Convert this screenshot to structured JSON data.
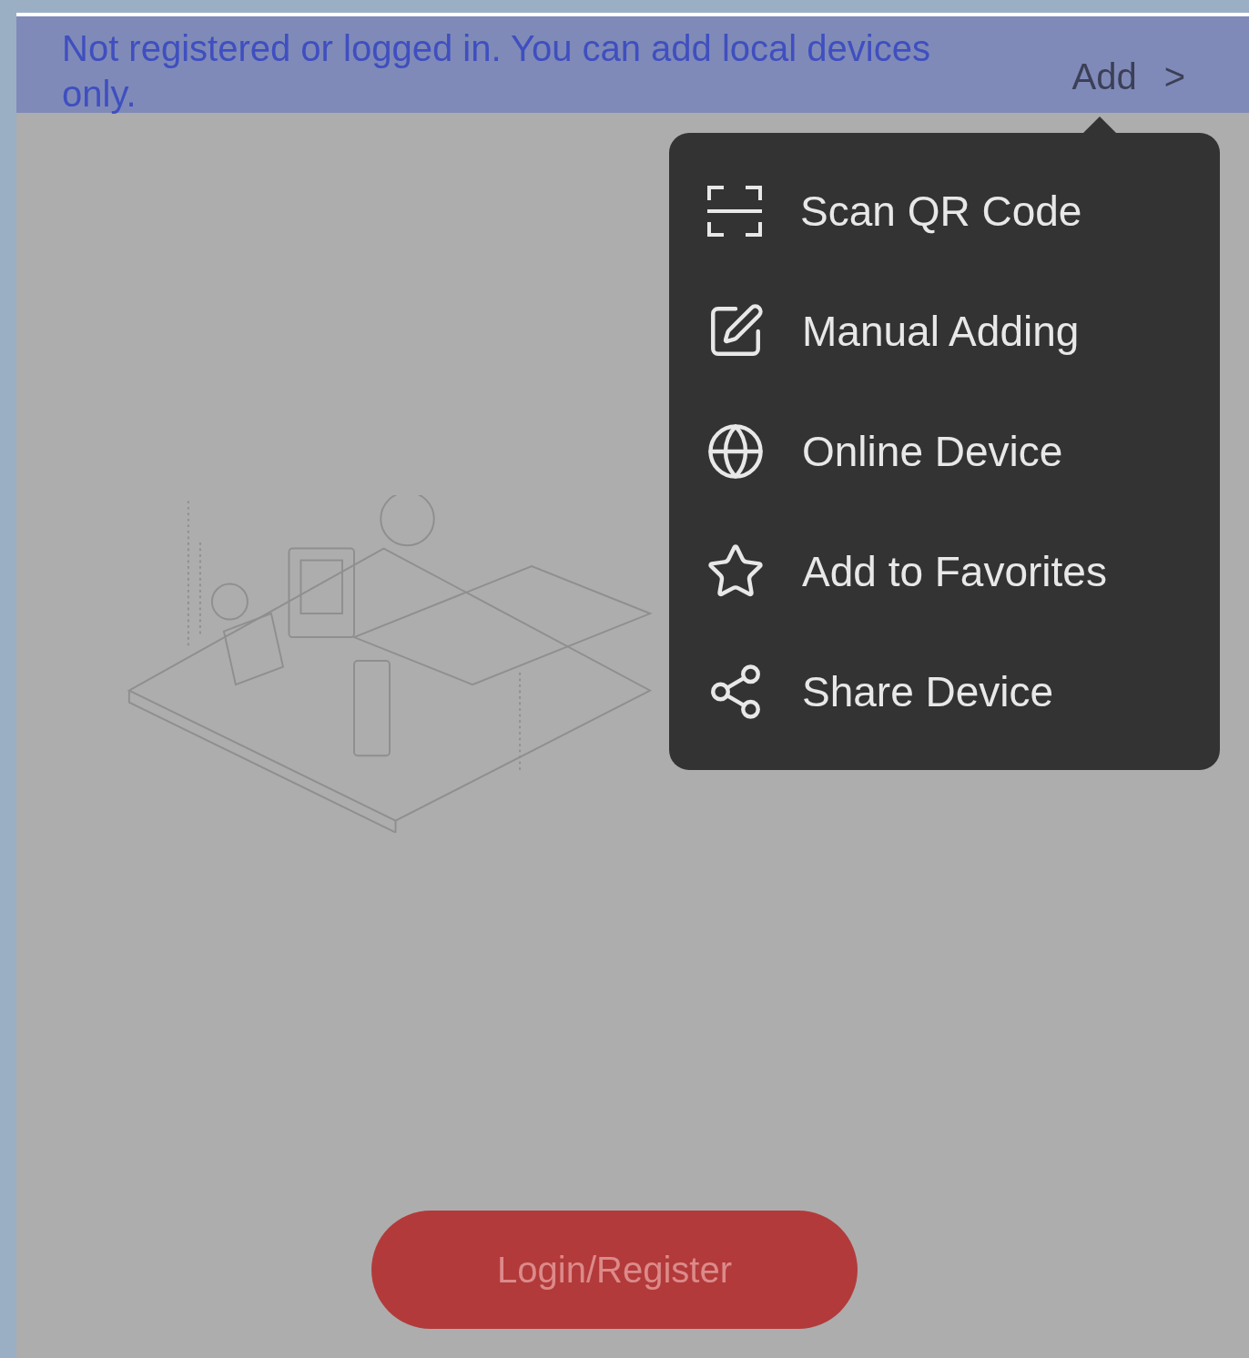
{
  "banner": {
    "message": "Not registered or logged in. You can add local devices only.",
    "add_label": "Add",
    "add_arrow": ">"
  },
  "menu": {
    "items": [
      {
        "kind": "scan",
        "label": "Scan QR Code"
      },
      {
        "kind": "manual",
        "label": "Manual Adding"
      },
      {
        "kind": "online",
        "label": "Online Device"
      },
      {
        "kind": "favorite",
        "label": "Add to Favorites"
      },
      {
        "kind": "share",
        "label": "Share Device"
      }
    ]
  },
  "login_button": "Login/Register"
}
